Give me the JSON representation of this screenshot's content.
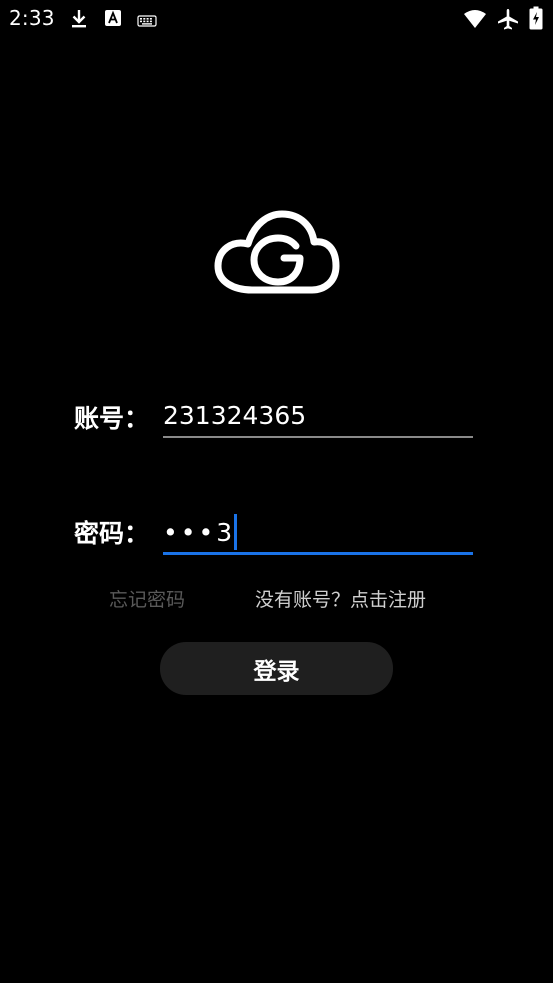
{
  "status_bar": {
    "time": "2:33",
    "left_icons": [
      "download-icon",
      "text-a-icon",
      "keyboard-icon"
    ],
    "right_icons": [
      "wifi-icon",
      "airplane-mode-icon",
      "battery-charging-icon"
    ]
  },
  "logo": {
    "icon": "cloud-g-logo-icon"
  },
  "form": {
    "account": {
      "label": "账号：",
      "value": "231324365"
    },
    "password": {
      "label": "密码：",
      "masked": "•••",
      "last_char": "3"
    }
  },
  "links": {
    "forgot_password": "忘记密码",
    "register": "没有账号？点击注册"
  },
  "login_button": {
    "label": "登录"
  },
  "colors": {
    "background": "#000000",
    "text": "#ffffff",
    "focus_accent": "#1a73e8",
    "inactive_underline": "#8a8a8a",
    "disabled_link": "#5a5a5a",
    "link": "#cfcfcf",
    "button_bg": "#1f1f1f"
  }
}
